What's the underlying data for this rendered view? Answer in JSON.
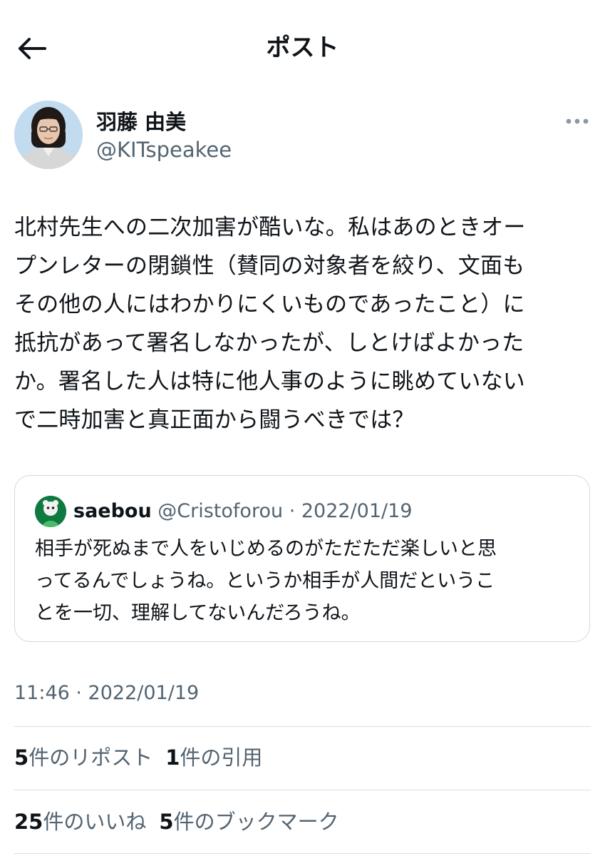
{
  "header": {
    "title": "ポスト",
    "back_icon": "arrow-left-icon"
  },
  "author": {
    "display_name": "羽藤 由美",
    "handle": "@KITspeakee",
    "more_icon": "more-horizontal-icon"
  },
  "post": {
    "text": "北村先生への二次加害が酷いな。私はあのときオー\nプンレターの閉鎖性（賛同の対象者を絞り、文面も\nその他の人にはわかりにくいものであったこと）に\n抵抗があって署名しなかったが、しとけばよかった\nか。署名した人は特に他人事のように眺めていない\nで二時加害と真正面から闘うべきでは？",
    "timestamp": "11:46 · 2022/01/19"
  },
  "quoted": {
    "name": "saebou",
    "handle": "@Cristoforou",
    "separator": "·",
    "date": "2022/01/19",
    "text": "相手が死ぬまで人をいじめるのがただただ楽しいと思\nってるんでしょうね。というか相手が人間だというこ\nとを一切、理解してないんだろうね。"
  },
  "stats": {
    "reposts_count": "5",
    "reposts_label": "件のリポスト",
    "quotes_count": "1",
    "quotes_label": "件の引用",
    "likes_count": "25",
    "likes_label": "件のいいね",
    "bookmarks_count": "5",
    "bookmarks_label": "件のブックマーク"
  },
  "colors": {
    "text_primary": "#0f1419",
    "text_secondary": "#536471",
    "border": "#cfd9de"
  }
}
